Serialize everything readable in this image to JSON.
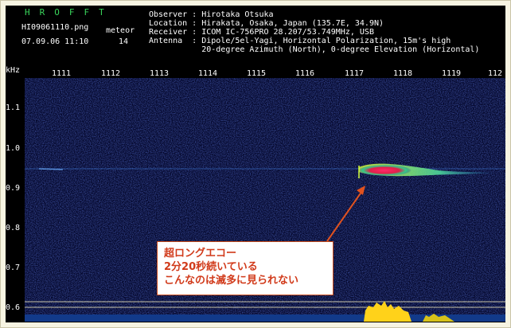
{
  "header": {
    "logo": "HROFFT",
    "filename": "HI09061110.png",
    "datetime": "07.09.06 11:10",
    "meteor_label": "meteor",
    "meteor_count": "14",
    "observer_line": "Observer : Hirotaka Otsuka",
    "location_line": "Location : Hirakata, Osaka, Japan (135.7E, 34.9N)",
    "receiver_line": "Receiver : ICOM IC-756PRO 28.207/53.749MHz, USB",
    "antenna_line": "Antenna  : Dipole/5el-Yagi, Horizontal Polarization, 15m's high",
    "antenna_line2": "           20-degree Azimuth (North), 0-degree Elevation (Horizontal)"
  },
  "axes": {
    "y_unit": "kHz",
    "y_ticks": [
      "1.1",
      "1.0",
      "0.9",
      "0.8",
      "0.7",
      "0.6"
    ],
    "x_ticks": [
      "1111",
      "1112",
      "1113",
      "1114",
      "1115",
      "1116",
      "1117",
      "1118",
      "1119",
      "112"
    ]
  },
  "annotation": {
    "line1": "超ロングエコー",
    "line2": "2分20秒続いている",
    "line3": "こんなのは滅多に見られない",
    "text_color": "#d13a1a"
  },
  "colors": {
    "background": "#000000",
    "noise": "#1a2a9a",
    "echo_core": "#ff2a6a",
    "logo": "#39d35a"
  }
}
